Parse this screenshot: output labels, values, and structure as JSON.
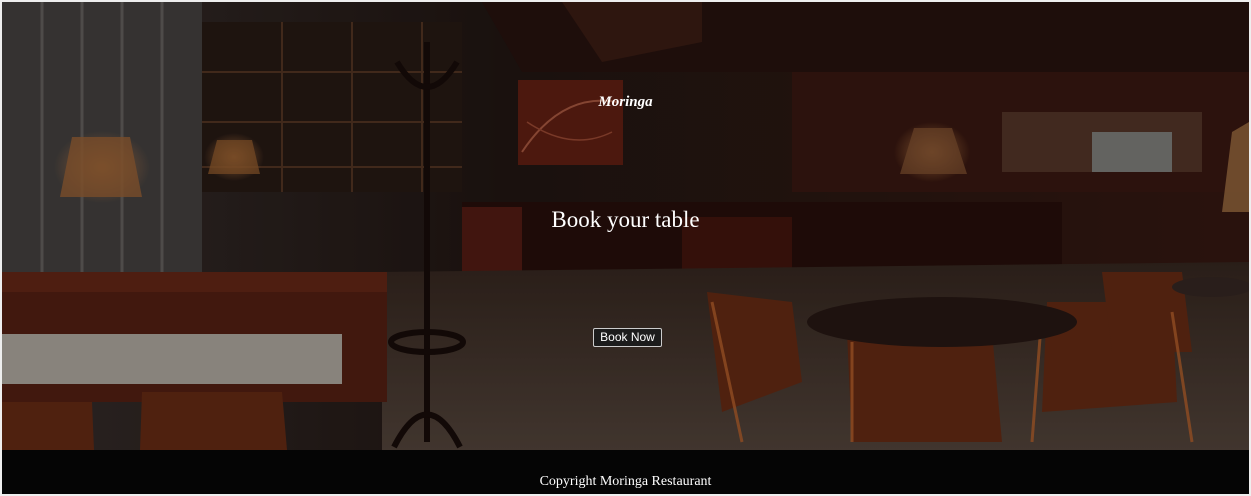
{
  "hero": {
    "brand": "Moringa",
    "headline": "Book your table",
    "cta_label": "Book Now",
    "image_desc": "dim restaurant interior"
  },
  "footer": {
    "copyright": "Copyright Moringa Restaurant"
  },
  "colors": {
    "footer_bg": "#050505",
    "text": "#ffffff"
  }
}
